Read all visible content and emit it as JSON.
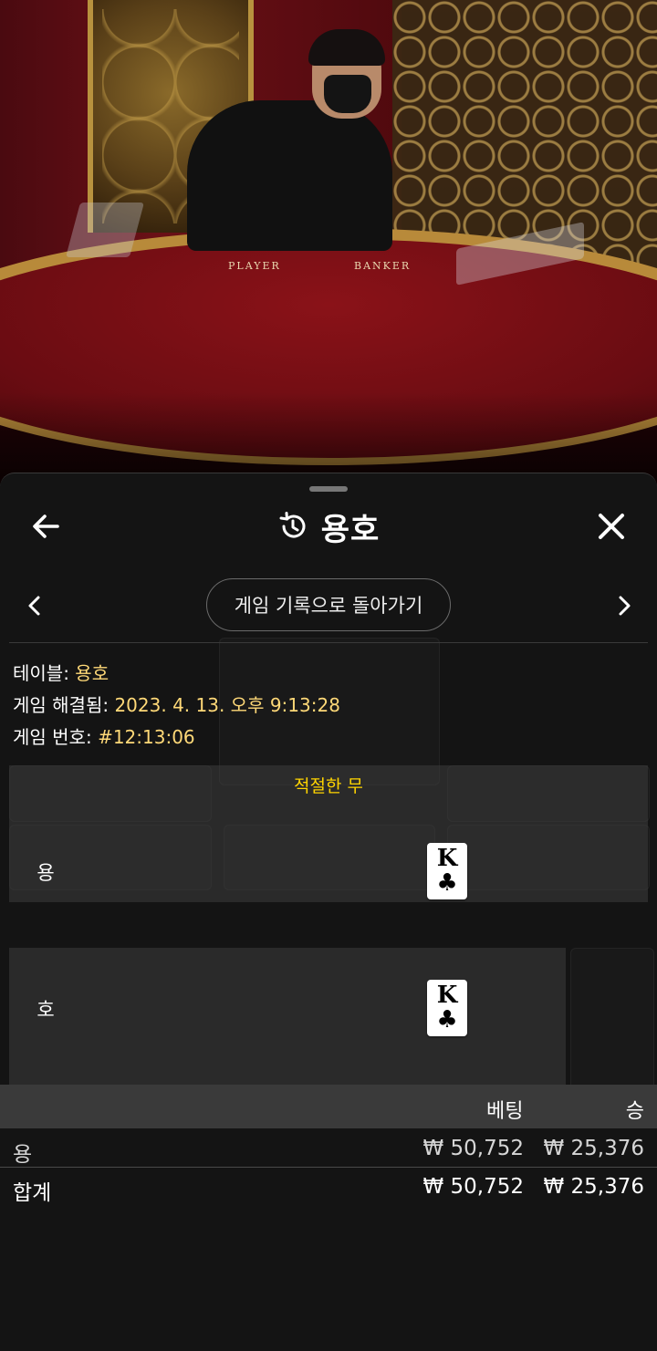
{
  "video": {
    "table_labels": {
      "player": "PLAYER",
      "banker": "BANKER"
    }
  },
  "header": {
    "title": "용호",
    "back_icon": "arrow-left-icon",
    "history_icon": "history-icon",
    "close_icon": "close-icon"
  },
  "nav": {
    "history_button_label": "게임 기록으로 돌아가기",
    "prev_icon": "chevron-left-icon",
    "next_icon": "chevron-right-icon"
  },
  "info": {
    "table_label": "테이블: ",
    "table_value": "용호",
    "resolved_label": "게임 해결됨: ",
    "resolved_value": "2023. 4. 13. 오후 9:13:28",
    "game_no_label": "게임 번호: ",
    "game_no_value": "#12:13:06"
  },
  "result": {
    "outcome_text": "적절한 무",
    "dragon": {
      "label": "용",
      "card_rank": "K",
      "card_suit": "♣"
    },
    "tiger": {
      "label": "호",
      "card_rank": "K",
      "card_suit": "♣"
    }
  },
  "bets": {
    "columns": {
      "bet": "베팅",
      "win": "승"
    },
    "rows": [
      {
        "name": "용",
        "bet": "₩ 50,752",
        "win": "₩ 25,376"
      }
    ],
    "total": {
      "name": "합계",
      "bet": "₩ 50,752",
      "win": "₩ 25,376"
    }
  },
  "colors": {
    "accent_yellow": "#ffd400",
    "info_value": "#ffd978",
    "sheet_bg": "#141414"
  }
}
